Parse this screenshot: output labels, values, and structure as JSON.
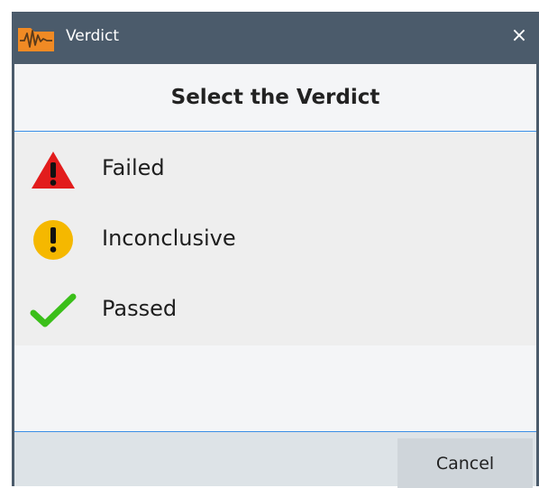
{
  "window": {
    "title": "Verdict",
    "close_glyph": "×",
    "app_icon": "waveform-folder-icon"
  },
  "dialog": {
    "heading": "Select the Verdict"
  },
  "options": [
    {
      "label": "Failed",
      "icon": "warning-triangle-icon",
      "color": "#e21c1c"
    },
    {
      "label": "Inconclusive",
      "icon": "exclamation-circle-icon",
      "color": "#f5b800"
    },
    {
      "label": "Passed",
      "icon": "checkmark-icon",
      "color": "#3bbf1a"
    }
  ],
  "footer": {
    "cancel_label": "Cancel"
  },
  "colors": {
    "titlebar": "#4b5b6b",
    "accent_line": "#3a8ee6",
    "app_icon_orange": "#f08a24"
  }
}
